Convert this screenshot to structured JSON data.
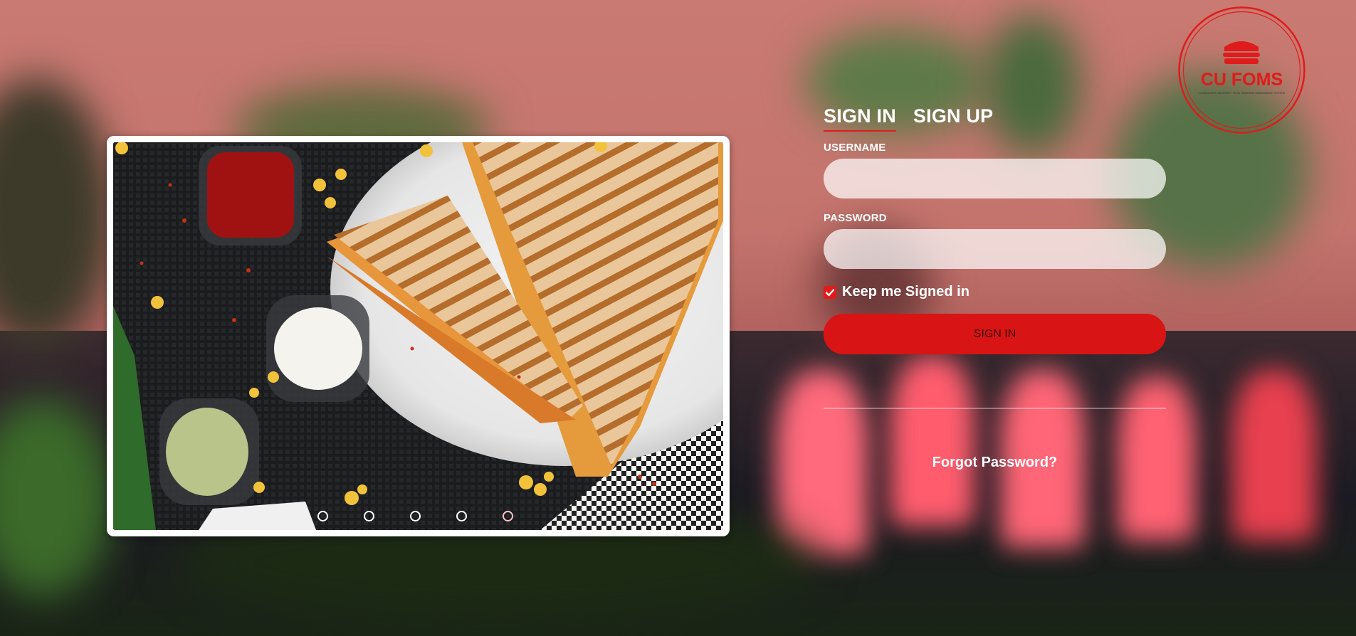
{
  "tabs": [
    {
      "label": "SIGN IN",
      "active": true
    },
    {
      "label": "SIGN UP",
      "active": false
    }
  ],
  "form": {
    "username_label": "USERNAME",
    "username_value": "",
    "password_label": "PASSWORD",
    "password_value": "",
    "keep_signed_in_label": "Keep me Signed in",
    "keep_signed_in_checked": true,
    "submit_label": "SIGN IN",
    "forgot_label": "Forgot Password?"
  },
  "logo": {
    "text": "CU FOMS",
    "tagline": "CHANDIGARH UNIVERSITY FOOD ORDERING MANAGEMENT SYSTEM"
  },
  "carousel": {
    "slide_count": 5,
    "active_index": 4
  },
  "colors": {
    "accent": "#d91414",
    "accent_dark": "#e01b1b",
    "text": "#ffffff"
  }
}
